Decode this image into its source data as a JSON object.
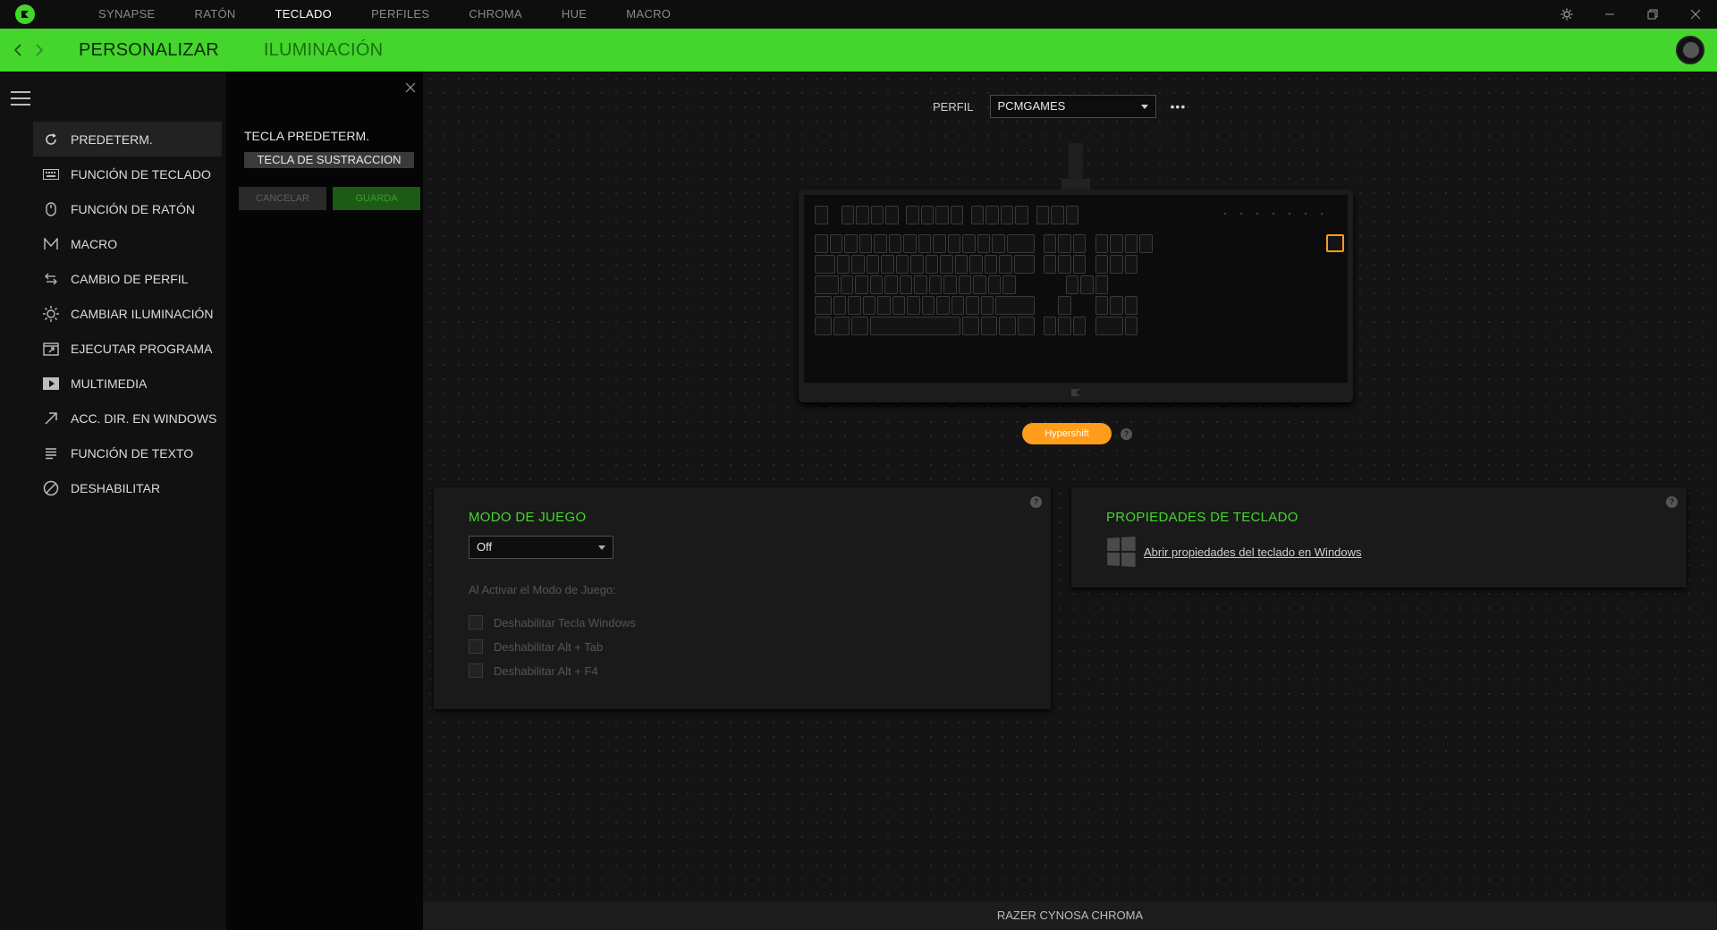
{
  "topnav": {
    "items": [
      "SYNAPSE",
      "RATÓN",
      "TECLADO",
      "PERFILES",
      "CHROMA",
      "HUE",
      "MACRO"
    ],
    "active_index": 2
  },
  "window_controls": {
    "settings_icon": "gear-icon",
    "minimize_icon": "minimize-icon",
    "restore_icon": "restore-icon",
    "close_icon": "close-icon"
  },
  "greenbar": {
    "tabs": [
      "PERSONALIZAR",
      "ILUMINACIÓN"
    ],
    "active_index": 0
  },
  "sidebar": {
    "items": [
      {
        "label": "PREDETERM.",
        "icon": "refresh-icon"
      },
      {
        "label": "FUNCIÓN DE TECLADO",
        "icon": "keyboard-icon"
      },
      {
        "label": "FUNCIÓN DE RATÓN",
        "icon": "mouse-icon"
      },
      {
        "label": "MACRO",
        "icon": "macro-icon"
      },
      {
        "label": "CAMBIO DE PERFIL",
        "icon": "swap-icon"
      },
      {
        "label": "CAMBIAR ILUMINACIÓN",
        "icon": "sun-icon"
      },
      {
        "label": "EJECUTAR PROGRAMA",
        "icon": "launch-icon"
      },
      {
        "label": "MULTIMEDIA",
        "icon": "play-icon"
      },
      {
        "label": "ACC. DIR. EN WINDOWS",
        "icon": "arrow-up-right-icon"
      },
      {
        "label": "FUNCIÓN DE TEXTO",
        "icon": "text-icon"
      },
      {
        "label": "DESHABILITAR",
        "icon": "disable-icon"
      }
    ],
    "active_index": 0
  },
  "config": {
    "title": "TECLA PREDETERM.",
    "key_value": "TECLA DE SUSTRACCION",
    "cancel_label": "CANCELAR",
    "save_label": "GUARDA"
  },
  "profile": {
    "label": "PERFIL",
    "value": "PCMGAMES",
    "more": "•••"
  },
  "hypershift": {
    "label": "Hypershift",
    "help": "?"
  },
  "game_mode": {
    "title": "MODO DE JUEGO",
    "select_value": "Off",
    "subtitle": "Al Activar el Modo de Juego:",
    "options": [
      "Deshabilitar Tecla Windows",
      "Deshabilitar Alt + Tab",
      "Deshabilitar Alt + F4"
    ],
    "help": "?"
  },
  "keyboard_props": {
    "title": "PROPIEDADES DE TECLADO",
    "link": "Abrir propiedades del teclado en Windows",
    "help": "?"
  },
  "footer": {
    "device": "RAZER CYNOSA CHROMA"
  },
  "colors": {
    "accent": "#44d62c",
    "hypershift": "#ff9c19"
  }
}
